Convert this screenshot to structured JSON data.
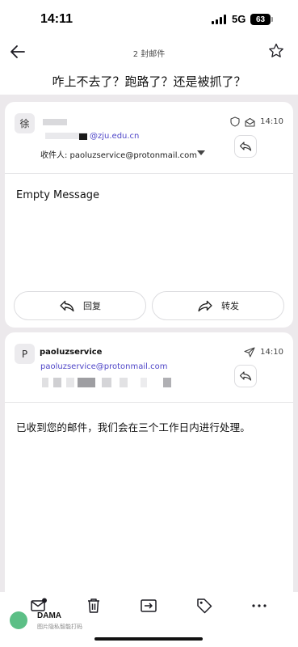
{
  "status_bar": {
    "time": "14:11",
    "network": "5G",
    "battery": "63"
  },
  "nav": {
    "message_count": "2 封邮件"
  },
  "subject": "咋上不去了？跑路了？还是被抓了？",
  "messages": [
    {
      "avatar": "徐",
      "sender_email": "@zju.edu.cn",
      "recipient": "收件人: paoluzservice@protonmail.com",
      "time": "14:10",
      "body": "Empty Message",
      "reply_label": "回复",
      "forward_label": "转发"
    },
    {
      "avatar": "P",
      "sender_name": "paoluzservice",
      "sender_email": "paoluzservice@protonmail.com",
      "time": "14:10",
      "body": "已收到您的邮件，我们会在三个工作日内进行处理。"
    }
  ],
  "watermark": {
    "title": "DAMA",
    "subtitle": "图片隐私智能打码"
  },
  "colors": {
    "accent": "#4f46c8",
    "thread_bg": "#ece9ec"
  },
  "icons": [
    "back-arrow-icon",
    "star-icon",
    "shield-icon",
    "envelope-open-icon",
    "paper-plane-icon",
    "reply-icon",
    "forward-icon",
    "mail-unread-icon",
    "trash-icon",
    "move-to-icon",
    "tag-icon",
    "more-icon"
  ]
}
